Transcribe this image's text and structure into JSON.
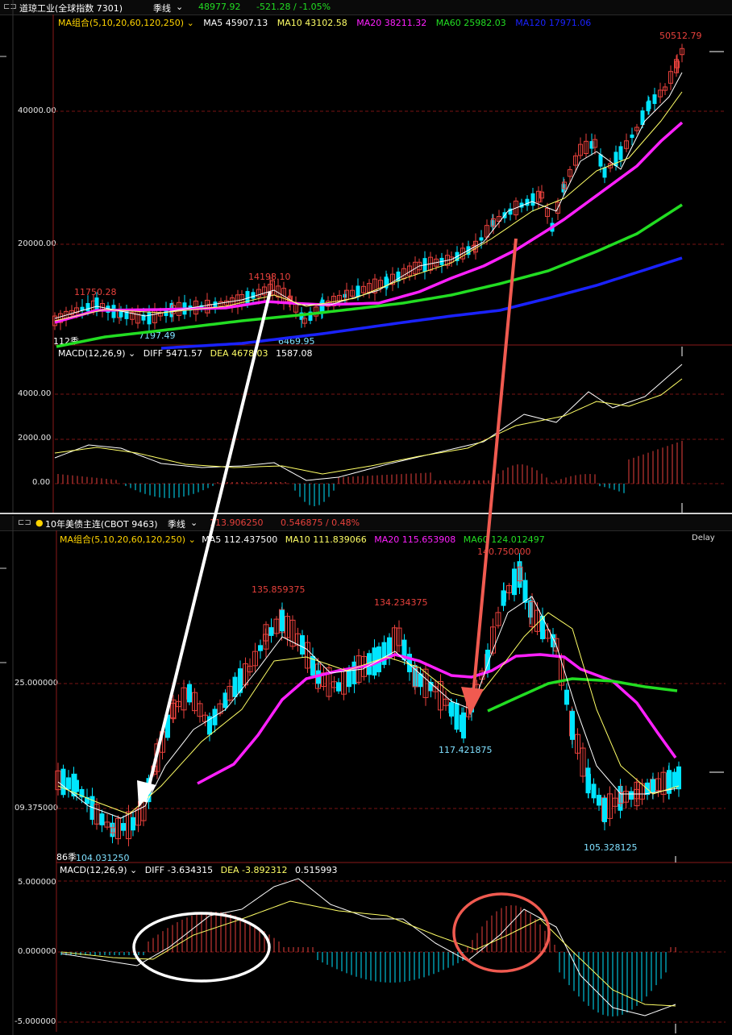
{
  "panels": [
    {
      "header": {
        "name": "道琼工业(全球指数 7301)",
        "period": "季线",
        "price": "48977.92",
        "change": "-521.28 / -1.05%"
      },
      "ma_line": {
        "label": "MA组合(5,10,20,60,120,250)",
        "ma5": "MA5 45907.13",
        "ma10": "MA10 43102.58",
        "ma20": "MA20 38211.32",
        "ma60": "MA60 25982.03",
        "ma120": "MA120 17971.06"
      },
      "macd_line": {
        "label": "MACD(12,26,9)",
        "diff": "DIFF 5471.57",
        "dea": "DEA 4678.03",
        "macd": "1587.08"
      },
      "price_ticks": [
        "40000.00",
        "20000.00"
      ],
      "macd_ticks": [
        "4000.00",
        "2000.00",
        "0.00"
      ],
      "annotations": [
        "11750.28",
        "14198.10",
        "7197.49",
        "6469.95",
        "50512.79"
      ],
      "period_label": "112季"
    },
    {
      "header": {
        "name": "10年美债主连(CBOT 9463)",
        "period": "季线",
        "price": "113.906250",
        "change": "0.546875 / 0.48%"
      },
      "ma_line": {
        "label": "MA组合(5,10,20,60,120,250)",
        "ma5": "MA5 112.437500",
        "ma10": "MA10 111.839066",
        "ma20": "MA20 115.653908",
        "ma60": "MA60 124.012497"
      },
      "delay": "Delay",
      "macd_line": {
        "label": "MACD(12,26,9)",
        "diff": "DIFF -3.634315",
        "dea": "DEA -3.892312",
        "macd": "0.515993"
      },
      "price_ticks": [
        "25.000000",
        "09.375000"
      ],
      "macd_ticks": [
        "5.000000",
        "0.000000",
        "-5.000000"
      ],
      "annotations": [
        "135.859375",
        "134.234375",
        "140.750000",
        "117.421875",
        "105.328125",
        "104.031250"
      ],
      "period_label": "86季"
    }
  ],
  "colors": {
    "up": "#e8413c",
    "down": "#00e5ff",
    "ma5": "#ffffff",
    "ma10": "#ffff66",
    "ma20": "#ff20ff",
    "ma60": "#22dd22",
    "ma120": "#1a22ff",
    "grid": "#7a1515"
  },
  "chart_data": [
    {
      "type": "line",
      "title": "道琼工业(全球指数 7301) 季线",
      "series": [
        {
          "name": "MA20",
          "x_quarter_index": [
            0,
            20,
            40,
            60,
            70,
            80,
            90,
            100,
            112
          ],
          "values": [
            10000,
            11000,
            10900,
            13500,
            17000,
            24000,
            30000,
            36000,
            38211.32
          ]
        },
        {
          "name": "MA60",
          "x_quarter_index": [
            0,
            40,
            60,
            80,
            100,
            112
          ],
          "values": [
            6000,
            9500,
            11000,
            14000,
            22000,
            25982.03
          ]
        },
        {
          "name": "MA120",
          "x_quarter_index": [
            40,
            70,
            90,
            112
          ],
          "values": [
            6000,
            9000,
            12500,
            17971.06
          ]
        }
      ],
      "points": [
        {
          "label": "11750.28",
          "value": 11750.28
        },
        {
          "label": "14198.10",
          "value": 14198.1
        },
        {
          "label": "7197.49",
          "value": 7197.49
        },
        {
          "label": "6469.95",
          "value": 6469.95
        },
        {
          "label": "50512.79",
          "value": 50512.79
        }
      ],
      "ylim": [
        5000,
        52000
      ]
    },
    {
      "type": "line",
      "title": "10年美债主连(CBOT 9463) 季线",
      "series": [
        {
          "name": "MA20",
          "values": [
            108,
            112,
            118,
            124,
            128,
            130,
            128,
            124,
            122,
            124,
            128,
            127,
            122,
            114
          ]
        },
        {
          "name": "MA60",
          "values": [
            118,
            123,
            126,
            125,
            124
          ]
        }
      ],
      "points": [
        {
          "label": "135.859375",
          "value": 135.859375
        },
        {
          "label": "134.234375",
          "value": 134.234375
        },
        {
          "label": "140.750000",
          "value": 140.75
        },
        {
          "label": "117.421875",
          "value": 117.421875
        },
        {
          "label": "105.328125",
          "value": 105.328125
        },
        {
          "label": "104.031250",
          "value": 104.03125
        }
      ],
      "ylim": [
        102,
        142
      ]
    }
  ]
}
